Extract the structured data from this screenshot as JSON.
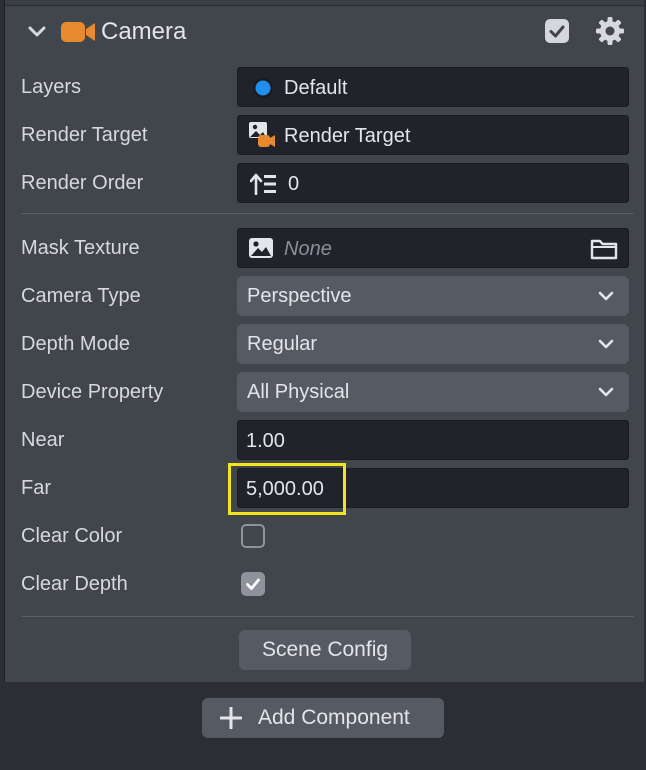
{
  "component": {
    "title": "Camera",
    "enabled": true,
    "icon": "camera-icon",
    "accent_color": "#e8892e"
  },
  "fields": {
    "layers": {
      "label": "Layers",
      "value": "Default",
      "icon_color": "#1e8ff0"
    },
    "render_target": {
      "label": "Render Target",
      "value": "Render Target"
    },
    "render_order": {
      "label": "Render Order",
      "value": "0"
    },
    "mask_texture": {
      "label": "Mask Texture",
      "value": "None"
    },
    "camera_type": {
      "label": "Camera Type",
      "value": "Perspective"
    },
    "depth_mode": {
      "label": "Depth Mode",
      "value": "Regular"
    },
    "device_property": {
      "label": "Device Property",
      "value": "All Physical"
    },
    "near": {
      "label": "Near",
      "value": "1.00"
    },
    "far": {
      "label": "Far",
      "value": "5,000.00"
    },
    "clear_color": {
      "label": "Clear Color",
      "checked": false
    },
    "clear_depth": {
      "label": "Clear Depth",
      "checked": true
    }
  },
  "buttons": {
    "scene_config": "Scene Config",
    "add_component": "Add Component"
  },
  "highlight_color": "#f2e51c"
}
